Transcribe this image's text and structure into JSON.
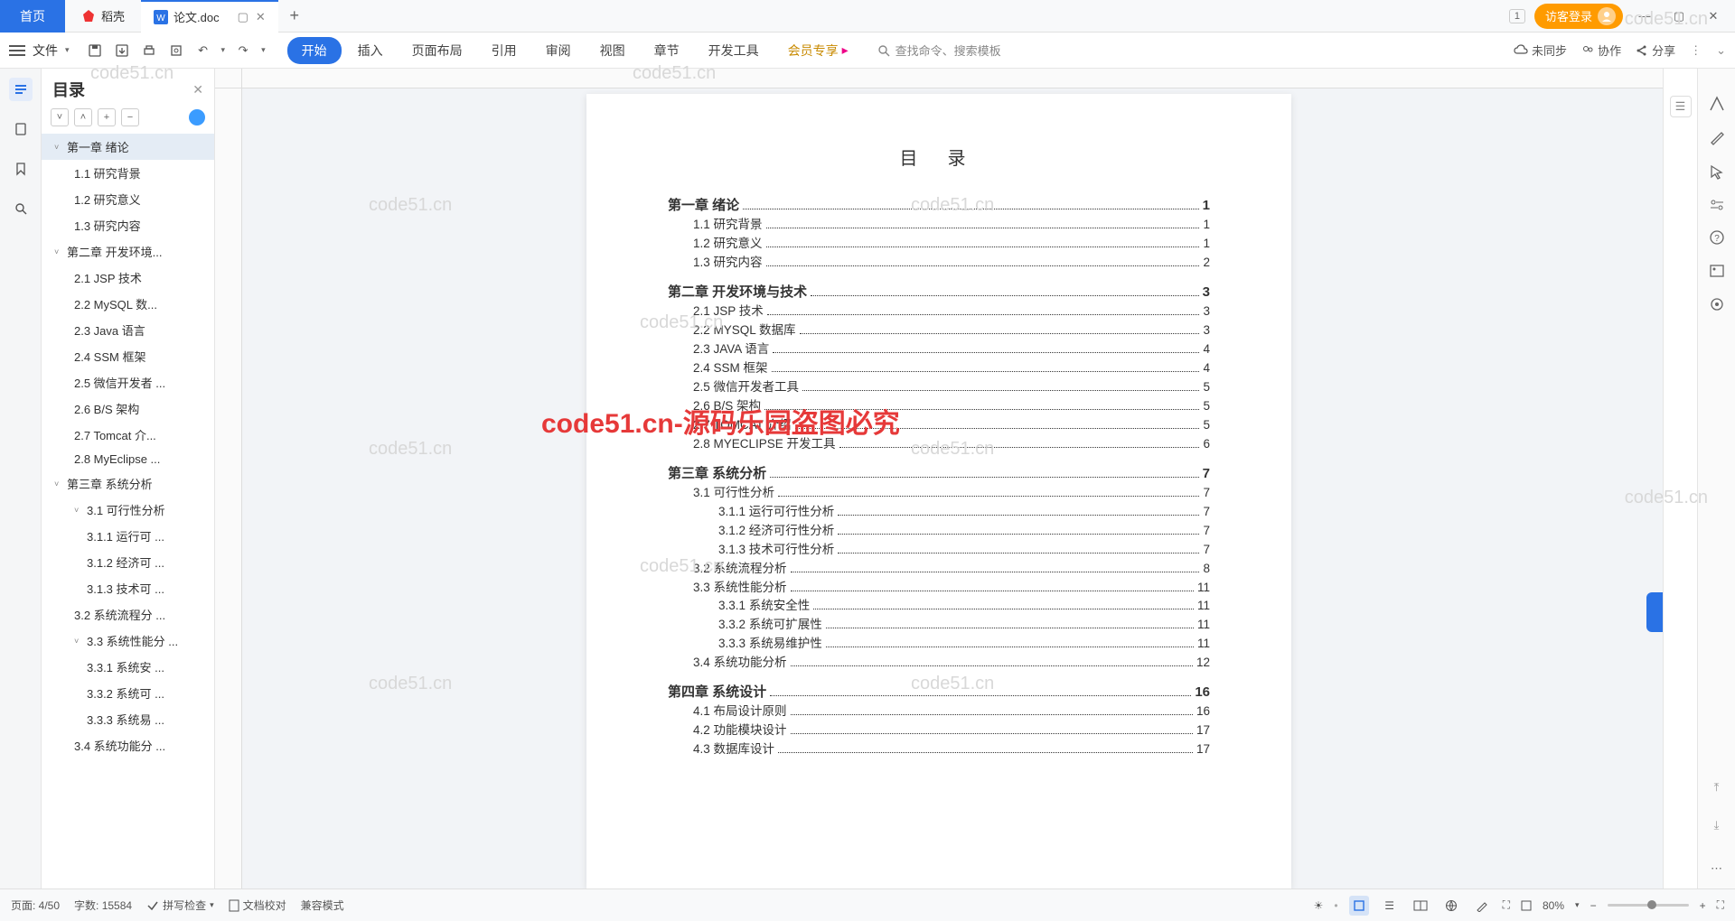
{
  "titleBar": {
    "homeTab": "首页",
    "appTab": "稻壳",
    "docTab": "论文.doc",
    "loginBadge": "访客登录",
    "badge1": "1"
  },
  "ribbon": {
    "fileLabel": "文件",
    "tabs": [
      "开始",
      "插入",
      "页面布局",
      "引用",
      "审阅",
      "视图",
      "章节",
      "开发工具"
    ],
    "vipTab": "会员专享",
    "searchPlaceholder": "查找命令、搜索模板",
    "unsync": "未同步",
    "collab": "协作",
    "share": "分享"
  },
  "outline": {
    "title": "目录",
    "items": [
      {
        "lvl": 1,
        "text": "第一章  绪论",
        "chev": "˅",
        "sel": true
      },
      {
        "lvl": 2,
        "text": "1.1 研究背景"
      },
      {
        "lvl": 2,
        "text": "1.2 研究意义"
      },
      {
        "lvl": 2,
        "text": "1.3 研究内容"
      },
      {
        "lvl": 1,
        "text": "第二章  开发环境...",
        "chev": "˅"
      },
      {
        "lvl": 2,
        "text": "2.1 JSP 技术"
      },
      {
        "lvl": 2,
        "text": "2.2 MySQL 数..."
      },
      {
        "lvl": 2,
        "text": "2.3 Java 语言"
      },
      {
        "lvl": 2,
        "text": "2.4 SSM 框架"
      },
      {
        "lvl": 2,
        "text": "2.5 微信开发者 ..."
      },
      {
        "lvl": 2,
        "text": "2.6 B/S 架构"
      },
      {
        "lvl": 2,
        "text": "2.7 Tomcat  介..."
      },
      {
        "lvl": 2,
        "text": "2.8 MyEclipse  ..."
      },
      {
        "lvl": 1,
        "text": "第三章  系统分析",
        "chev": "˅"
      },
      {
        "lvl": 2,
        "text": "3.1 可行性分析",
        "chev": "˅"
      },
      {
        "lvl": 3,
        "text": "3.1.1 运行可 ..."
      },
      {
        "lvl": 3,
        "text": "3.1.2 经济可 ..."
      },
      {
        "lvl": 3,
        "text": "3.1.3 技术可 ..."
      },
      {
        "lvl": 2,
        "text": "3.2 系统流程分 ..."
      },
      {
        "lvl": 2,
        "text": "3.3 系统性能分 ...",
        "chev": "˅"
      },
      {
        "lvl": 3,
        "text": "3.3.1 系统安 ..."
      },
      {
        "lvl": 3,
        "text": "3.3.2 系统可 ..."
      },
      {
        "lvl": 3,
        "text": "3.3.3 系统易 ..."
      },
      {
        "lvl": 2,
        "text": "3.4 系统功能分 ..."
      }
    ]
  },
  "toc": {
    "title": "目 录",
    "lines": [
      {
        "lvl": "h1",
        "t": "第一章  绪论",
        "p": "1"
      },
      {
        "lvl": "h2",
        "t": "1.1 研究背景",
        "p": "1"
      },
      {
        "lvl": "h2",
        "t": "1.2 研究意义",
        "p": "1"
      },
      {
        "lvl": "h2",
        "t": "1.3 研究内容",
        "p": "2"
      },
      {
        "lvl": "h1",
        "t": "第二章  开发环境与技术",
        "p": "3"
      },
      {
        "lvl": "h2",
        "t": "2.1 JSP 技术",
        "p": "3"
      },
      {
        "lvl": "h2",
        "t": "2.2 MYSQL 数据库",
        "p": "3"
      },
      {
        "lvl": "h2",
        "t": "2.3 JAVA 语言",
        "p": "4"
      },
      {
        "lvl": "h2",
        "t": "2.4 SSM 框架",
        "p": "4"
      },
      {
        "lvl": "h2",
        "t": "2.5 微信开发者工具",
        "p": "5"
      },
      {
        "lvl": "h2",
        "t": "2.6 B/S 架构",
        "p": "5"
      },
      {
        "lvl": "h2",
        "t": "2.7 TOMCAT 介绍",
        "p": "5"
      },
      {
        "lvl": "h2",
        "t": "2.8 MYECLIPSE 开发工具",
        "p": "6"
      },
      {
        "lvl": "h1",
        "t": "第三章  系统分析",
        "p": "7"
      },
      {
        "lvl": "h2",
        "t": "3.1 可行性分析",
        "p": "7"
      },
      {
        "lvl": "h3",
        "t": "3.1.1 运行可行性分析",
        "p": "7"
      },
      {
        "lvl": "h3",
        "t": "3.1.2 经济可行性分析",
        "p": "7"
      },
      {
        "lvl": "h3",
        "t": "3.1.3 技术可行性分析",
        "p": "7"
      },
      {
        "lvl": "h2",
        "t": "3.2 系统流程分析",
        "p": "8"
      },
      {
        "lvl": "h2",
        "t": "3.3 系统性能分析",
        "p": "11"
      },
      {
        "lvl": "h3",
        "t": "3.3.1 系统安全性",
        "p": "11"
      },
      {
        "lvl": "h3",
        "t": "3.3.2 系统可扩展性",
        "p": "11"
      },
      {
        "lvl": "h3",
        "t": "3.3.3 系统易维护性",
        "p": "11"
      },
      {
        "lvl": "h2",
        "t": "3.4 系统功能分析",
        "p": "12"
      },
      {
        "lvl": "h1",
        "t": "第四章  系统设计",
        "p": "16"
      },
      {
        "lvl": "h2",
        "t": "4.1 布局设计原则",
        "p": "16"
      },
      {
        "lvl": "h2",
        "t": "4.2 功能模块设计",
        "p": "17"
      },
      {
        "lvl": "h2",
        "t": "4.3 数据库设计",
        "p": "17"
      }
    ],
    "watermarkRed": "code51.cn-源码乐园盗图必究",
    "watermarkGray": "code51.cn"
  },
  "status": {
    "page": "页面: 4/50",
    "words": "字数: 15584",
    "spell": "拼写检查",
    "docCheck": "文档校对",
    "compat": "兼容模式",
    "zoom": "80%"
  }
}
